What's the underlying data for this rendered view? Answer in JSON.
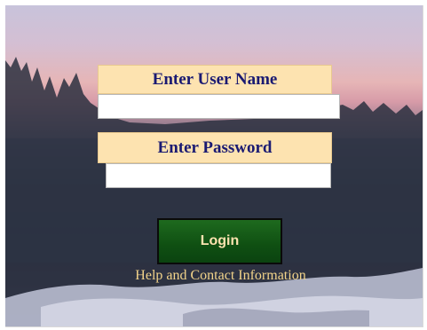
{
  "login_form": {
    "username_label": "Enter User Name",
    "username_value": "",
    "password_label": "Enter Password",
    "password_value": "",
    "login_button_label": "Login",
    "help_link_label": "Help and Contact Information"
  },
  "colors": {
    "caption_background": "#fde3b0",
    "caption_text": "#1a1a72",
    "button_background": "#0f4f12",
    "button_text": "#fde3b0",
    "help_link_text": "#f3d48a"
  }
}
